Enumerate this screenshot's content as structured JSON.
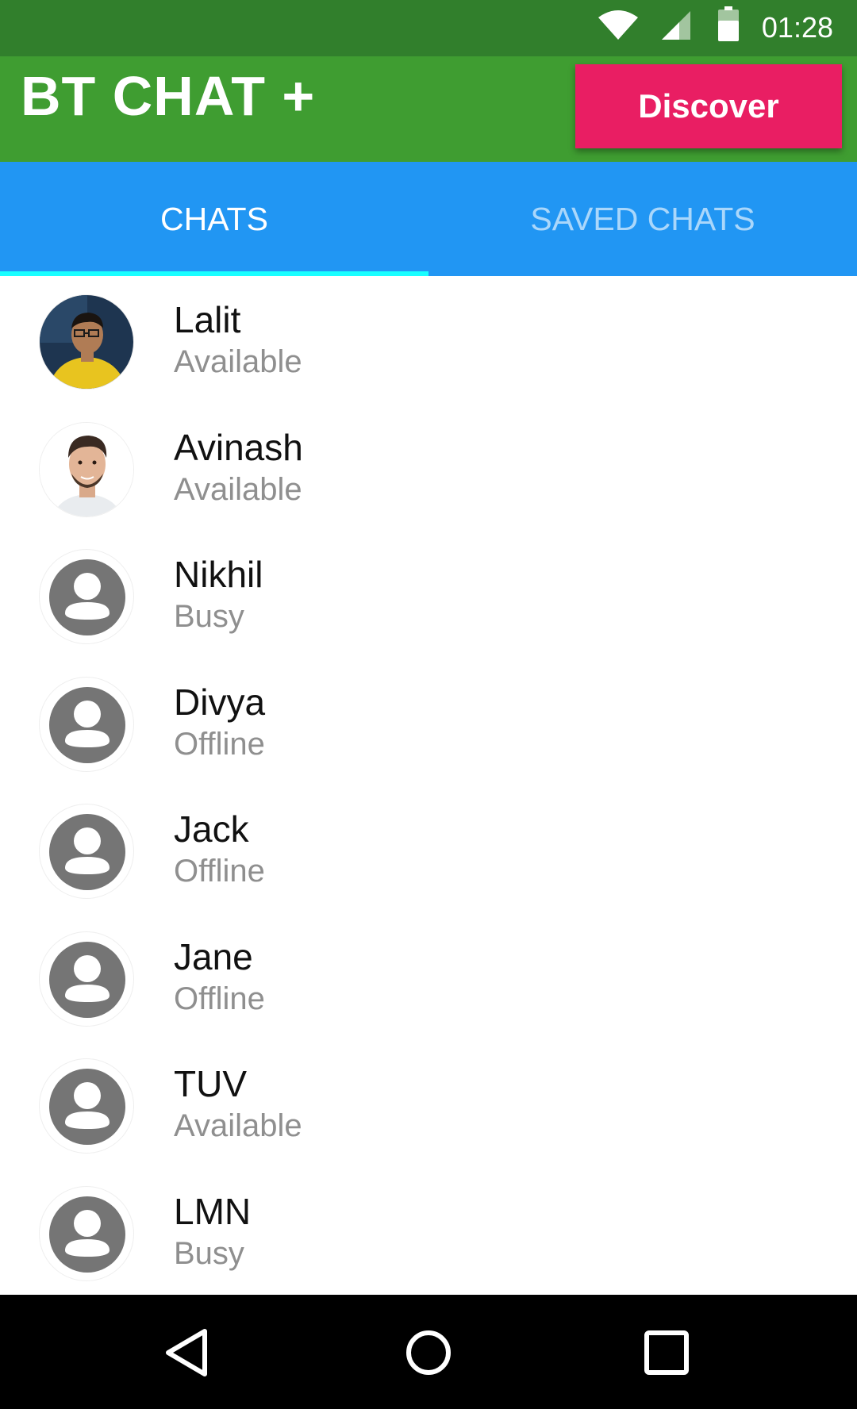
{
  "status_bar": {
    "time": "01:28",
    "icons": [
      "wifi-icon",
      "signal-icon",
      "battery-icon"
    ]
  },
  "app_bar": {
    "title": "BT CHAT +",
    "discover_label": "Discover",
    "color": "#3f9d31",
    "accent": "#e91e63"
  },
  "tabs": [
    {
      "label": "CHATS",
      "selected": true
    },
    {
      "label": "SAVED CHATS",
      "selected": false
    }
  ],
  "contacts": [
    {
      "name": "Lalit",
      "status": "Available",
      "avatar": "photo"
    },
    {
      "name": "Avinash",
      "status": "Available",
      "avatar": "photo"
    },
    {
      "name": "Nikhil",
      "status": "Busy",
      "avatar": "default-person-icon"
    },
    {
      "name": "Divya",
      "status": "Offline",
      "avatar": "default-person-icon"
    },
    {
      "name": "Jack",
      "status": "Offline",
      "avatar": "default-person-icon"
    },
    {
      "name": "Jane",
      "status": "Offline",
      "avatar": "default-person-icon"
    },
    {
      "name": "TUV",
      "status": "Available",
      "avatar": "default-person-icon"
    },
    {
      "name": "LMN",
      "status": "Busy",
      "avatar": "default-person-icon"
    }
  ],
  "nav_bar": {
    "buttons": [
      "back-icon",
      "home-icon",
      "recents-icon"
    ]
  }
}
